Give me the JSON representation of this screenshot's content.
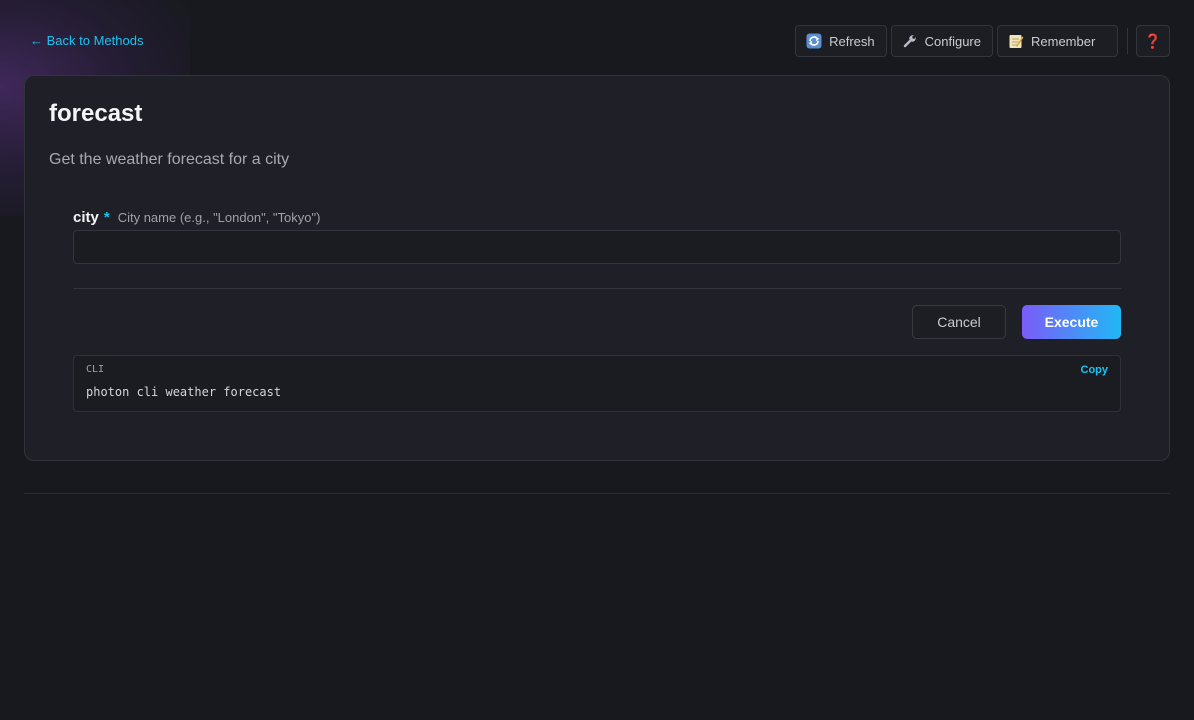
{
  "nav": {
    "back_label": "← Back to Methods"
  },
  "toolbar": {
    "refresh_label": "Refresh",
    "refresh_icon": "refresh-icon",
    "configure_label": "Configure",
    "configure_icon": "wrench-icon",
    "remember_label": "Remember",
    "remember_icon": "memo-icon",
    "help_label": "❓",
    "help_icon": "question-mark-icon"
  },
  "method": {
    "title": "forecast",
    "description": "Get the weather forecast for a city"
  },
  "params": {
    "city": {
      "name": "city",
      "required_marker": "*",
      "hint": "City name (e.g., \"London\", \"Tokyo\")",
      "value": "",
      "placeholder": ""
    }
  },
  "actions": {
    "cancel_label": "Cancel",
    "execute_label": "Execute"
  },
  "cli": {
    "label": "CLI",
    "copy_label": "Copy",
    "command": "photon cli weather forecast"
  },
  "colors": {
    "accent": "#19c3f0",
    "execute_gradient_start": "#7a5cf8",
    "execute_gradient_end": "#21b8f5",
    "help_icon": "#d12424",
    "background": "#18191e",
    "card": "#1f2027"
  }
}
